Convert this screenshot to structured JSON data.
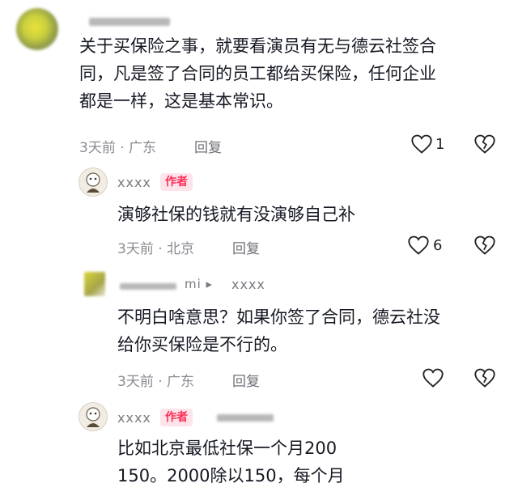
{
  "comments": [
    {
      "text_lines": [
        "关于买保险之事，就要看演员有无与德云社签合",
        "同，凡是签了合同的员工都给买保险，任何企业",
        "都是一样，这是基本常识。"
      ],
      "meta": "3天前 · 广东",
      "reply_label": "回复",
      "like_count": "1"
    },
    {
      "username": "xxxx",
      "badge": "作者",
      "text_lines": [
        "演够社保的钱就有没演够自己补"
      ],
      "meta": "3天前 · 北京",
      "reply_label": "回复",
      "like_count": "6"
    },
    {
      "username_prefix": "mi ▸",
      "username": "xxxx",
      "text_lines": [
        "不明白啥意思？如果你签了合同，德云社没",
        "给你买保险是不行的。"
      ],
      "meta": "3天前 · 广东",
      "reply_label": "回复",
      "like_count": ""
    },
    {
      "username": "xxxx",
      "badge": "作者",
      "text_lines": [
        "比如北京最低社保一个月200",
        "150。2000除以150，每个月"
      ]
    }
  ],
  "colors": {
    "text": "#161823",
    "meta": "#8a8b91",
    "badge_bg": "#fde4ea",
    "badge_fg": "#fe2c55"
  },
  "icons": [
    "heart-icon",
    "broken-heart-icon"
  ]
}
